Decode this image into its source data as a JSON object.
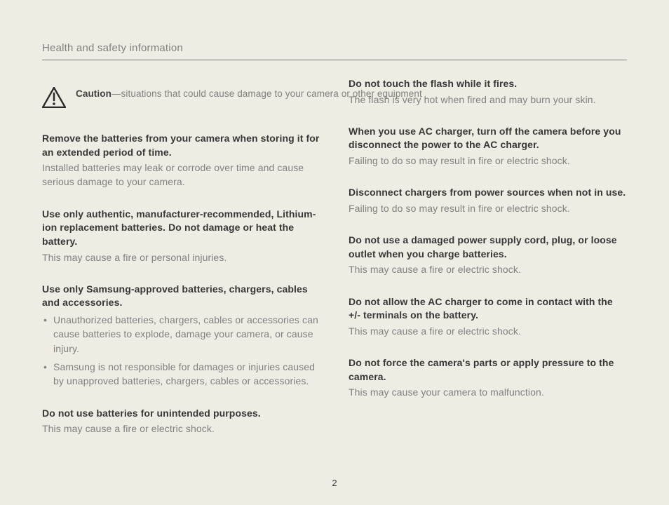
{
  "header": {
    "title": "Health and safety information"
  },
  "caution": {
    "label": "Caution",
    "desc": "—situations that could cause damage to your camera or other equipment"
  },
  "left": {
    "s1": {
      "h": "Remove the batteries from your camera when storing it for an extended period of time.",
      "b": "Installed batteries may leak or corrode over time and cause serious damage to your camera."
    },
    "s2": {
      "h": "Use only authentic, manufacturer-recommended, Lithium-ion replacement batteries. Do not damage or heat the battery.",
      "b": "This may cause a fire or personal injuries."
    },
    "s3": {
      "h": "Use only Samsung-approved batteries, chargers, cables and accessories.",
      "bullets": [
        "Unauthorized batteries, chargers, cables or accessories can cause batteries to explode, damage your camera, or cause injury.",
        "Samsung is not responsible for damages or injuries caused by unapproved batteries, chargers, cables or accessories."
      ]
    },
    "s4": {
      "h": "Do not use batteries for unintended purposes.",
      "b": "This may cause a fire or electric shock."
    }
  },
  "right": {
    "s1": {
      "h": "Do not touch the flash while it fires.",
      "b": "The flash is very hot when fired and may burn your skin."
    },
    "s2": {
      "h": "When you use AC charger, turn off the camera before you disconnect the power to the AC charger.",
      "b": "Failing to do so may result in fire or electric shock."
    },
    "s3": {
      "h": "Disconnect chargers from power sources when not in use.",
      "b": "Failing to do so may result in fire or electric shock."
    },
    "s4": {
      "h": "Do not use a damaged power supply cord, plug, or loose outlet when you charge batteries.",
      "b": "This may cause a fire or electric shock."
    },
    "s5": {
      "h": "Do not allow the AC charger to come in contact with the +/- terminals on the battery.",
      "b": "This may cause a fire or electric shock."
    },
    "s6": {
      "h": "Do not force the camera's parts or apply pressure to the camera.",
      "b": "This may cause your camera to malfunction."
    }
  },
  "page_number": "2"
}
